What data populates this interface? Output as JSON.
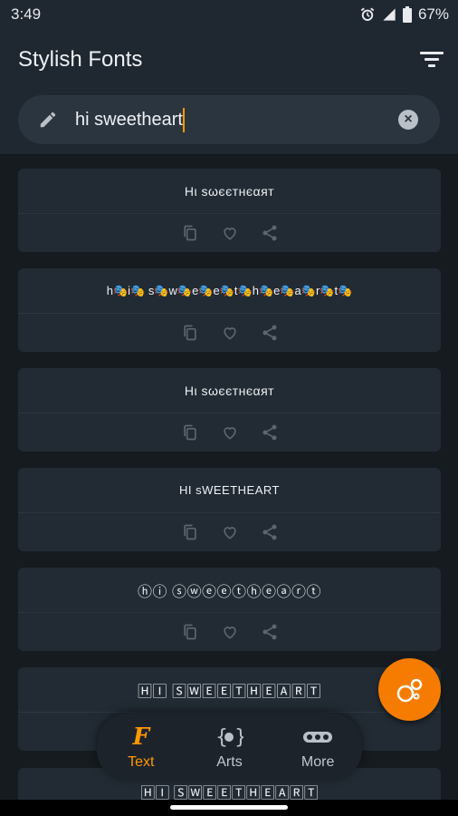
{
  "status_bar": {
    "time": "3:49",
    "battery": "67%"
  },
  "app": {
    "title": "Stylish Fonts"
  },
  "search": {
    "value": "hi sweetheart"
  },
  "cards": [
    {
      "text": "Hι ѕωєєтнєαят"
    },
    {
      "text": "h🎭i🎭 s🎭w🎭e🎭e🎭t🎭h🎭e🎭a🎭r🎭t🎭"
    },
    {
      "text": "Hι ѕωєєтнєαят"
    },
    {
      "text": "HI sWEETHEART"
    },
    {
      "text": "ⓗⓘ ⓢⓦⓔⓔⓣⓗⓔⓐⓡⓣ"
    },
    {
      "text": "🄷🄸 🅂🅆🄴🄴🅃🄷🄴🄰🅁🅃"
    }
  ],
  "peek_card": {
    "text": "🄷🄸 🅂🅆🄴🄴🅃🄷🄴🄰🅁🅃"
  },
  "card_actions": {
    "copy_icon": "copy-icon",
    "favorite_icon": "heart-icon",
    "share_icon": "share-icon"
  },
  "bottom_nav": {
    "items": [
      {
        "label": "Text",
        "icon": "font-icon",
        "active": true
      },
      {
        "label": "Arts",
        "icon": "braces-icon",
        "active": false
      },
      {
        "label": "More",
        "icon": "dots-icon",
        "active": false
      }
    ]
  },
  "colors": {
    "accent": "#ff9800",
    "fab": "#f57c00",
    "background": "#161b20",
    "card": "#222b34",
    "appbar": "#1f2730"
  }
}
